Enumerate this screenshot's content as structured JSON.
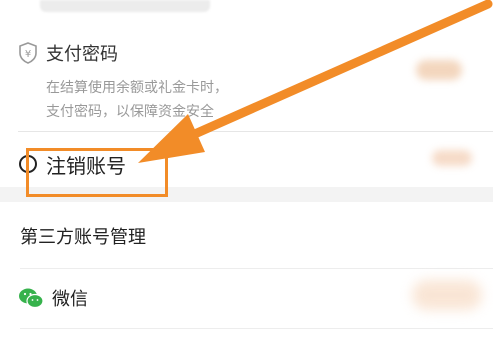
{
  "payment_password": {
    "title": "支付密码",
    "desc_line1": "在结算使用余额或礼金卡时，",
    "desc_line2": "支付密码，以保障资金安全"
  },
  "cancel_account": {
    "label": "注销账号"
  },
  "third_party": {
    "title": "第三方账号管理"
  },
  "wechat": {
    "label": "微信"
  },
  "colors": {
    "annotation_orange": "#f28c28",
    "wechat_green": "#36b24c"
  },
  "icons": {
    "payment": "shield-yen-icon",
    "wechat": "wechat-icon"
  }
}
